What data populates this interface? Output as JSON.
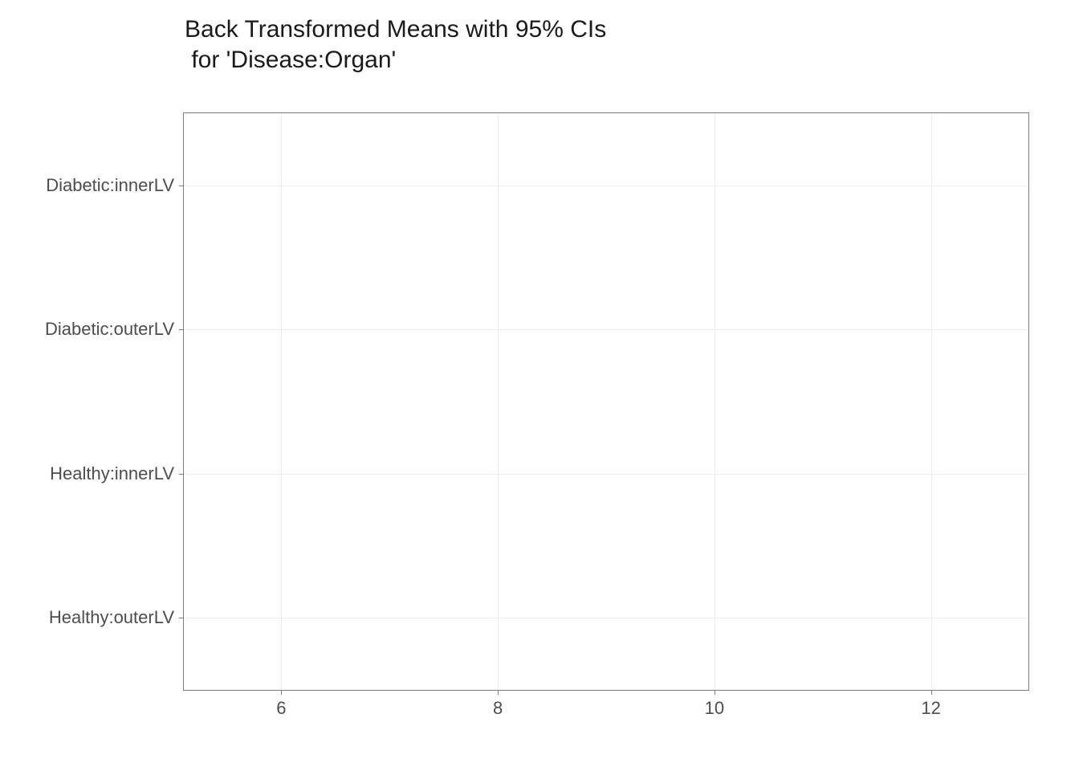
{
  "chart_data": {
    "type": "scatter",
    "title": "Back Transformed Means with 95% CIs\n for 'Disease:Organ'",
    "xlabel": "",
    "ylabel": "",
    "x_ticks": [
      6,
      8,
      10,
      12
    ],
    "x_range": [
      5.1,
      12.9
    ],
    "y_categories": [
      "Healthy:outerLV",
      "Healthy:innerLV",
      "Diabetic:outerLV",
      "Diabetic:innerLV"
    ],
    "series": [],
    "grid": true,
    "panel_border": true,
    "colors": {
      "grid": "#ececec",
      "axis": "#7d7d7d",
      "text": "#4d4d4d",
      "title": "#1a1a1a",
      "background": "#ffffff"
    }
  }
}
